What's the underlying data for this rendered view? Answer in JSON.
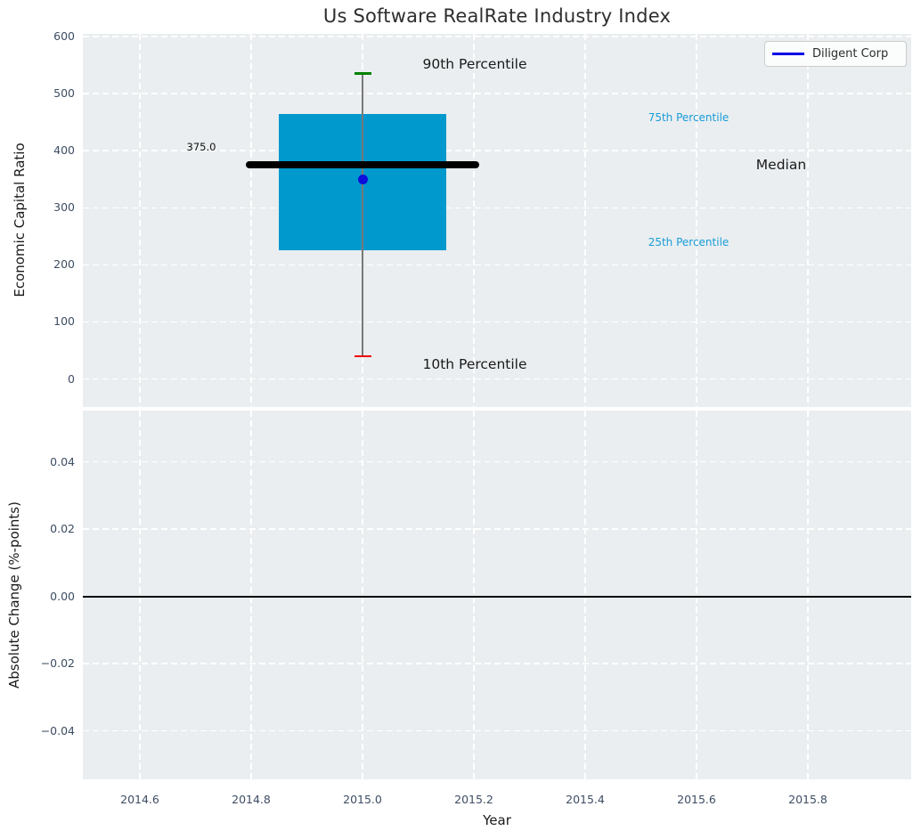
{
  "title": "Us Software RealRate Industry Index",
  "legend": {
    "label": "Diligent Corp",
    "line_color": "#0000e8",
    "position": "upper right"
  },
  "axes": {
    "top": {
      "ylabel": "Economic Capital Ratio",
      "yticks": [
        {
          "label": "600",
          "v": 600
        },
        {
          "label": "500",
          "v": 500
        },
        {
          "label": "400",
          "v": 400
        },
        {
          "label": "300",
          "v": 300
        },
        {
          "label": "200",
          "v": 200
        },
        {
          "label": "100",
          "v": 100
        },
        {
          "label": "0",
          "v": 0
        }
      ]
    },
    "bottom": {
      "ylabel": "Absolute Change (%-points)",
      "yticks": [
        {
          "label": "0.04",
          "v": 0.04
        },
        {
          "label": "0.02",
          "v": 0.02
        },
        {
          "label": "0.00",
          "v": 0.0
        },
        {
          "label": "−0.02",
          "v": -0.02
        },
        {
          "label": "−0.04",
          "v": -0.04
        }
      ]
    },
    "xlabel": "Year",
    "xticks": [
      {
        "label": "2014.6",
        "v": 2014.6
      },
      {
        "label": "2014.8",
        "v": 2014.8
      },
      {
        "label": "2015.0",
        "v": 2015.0
      },
      {
        "label": "2015.2",
        "v": 2015.2
      },
      {
        "label": "2015.4",
        "v": 2015.4
      },
      {
        "label": "2015.6",
        "v": 2015.6
      },
      {
        "label": "2015.8",
        "v": 2015.8
      }
    ]
  },
  "annotations": {
    "p90": "90th Percentile",
    "p75": "75th Percentile",
    "median": "Median",
    "p25": "25th Percentile",
    "p10": "10th Percentile",
    "median_value": "375.0"
  },
  "chart_data": [
    {
      "type": "boxplot",
      "title": "Us Software RealRate Industry Index",
      "xlabel": "Year",
      "ylabel": "Economic Capital Ratio",
      "x_center": 2015.0,
      "box_width_years": 0.3,
      "median_line_width_years": 0.41,
      "percentiles": {
        "p10": 40,
        "p25": 225,
        "median": 375,
        "p75": 465,
        "p90": 535
      },
      "median_label": "375.0",
      "company_point": {
        "name": "Diligent Corp",
        "x": 2015.0,
        "y": 350
      },
      "xlim": [
        2014.5,
        2015.99
      ],
      "ylim": [
        -52,
        603
      ],
      "grid": true,
      "legend_entries": [
        "Diligent Corp"
      ],
      "legend_position": "upper right",
      "colors": {
        "box": "#0099ce",
        "median": "#000000",
        "p90_cap": "#008000",
        "p10_cap": "#f00000",
        "whisker": "#787878",
        "point": "#0d0ddc",
        "annotation_cyan": "#189cd8",
        "plot_background": "#eaeef0"
      }
    },
    {
      "type": "line",
      "xlabel": "Year",
      "ylabel": "Absolute Change (%-points)",
      "xlim": [
        2014.5,
        2015.99
      ],
      "ylim": [
        -0.055,
        0.055
      ],
      "zero_line_y": 0.0,
      "series": [],
      "grid": true
    }
  ]
}
